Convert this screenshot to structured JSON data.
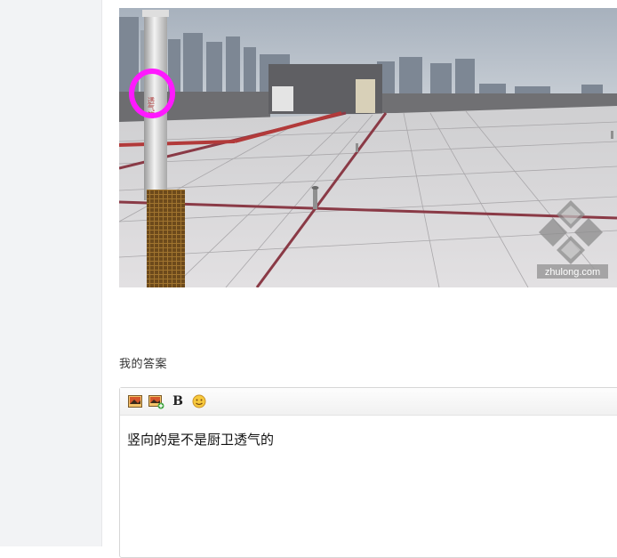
{
  "photo": {
    "watermark": "zhulong.com",
    "vent_label": "透气管",
    "accent_color": "#ff19ff"
  },
  "answer": {
    "label": "我的答案",
    "text": "竖向的是不是厨卫透气的"
  },
  "toolbar": {
    "items": [
      "image-icon",
      "image-upload-icon",
      "B",
      "emoji-icon"
    ]
  }
}
